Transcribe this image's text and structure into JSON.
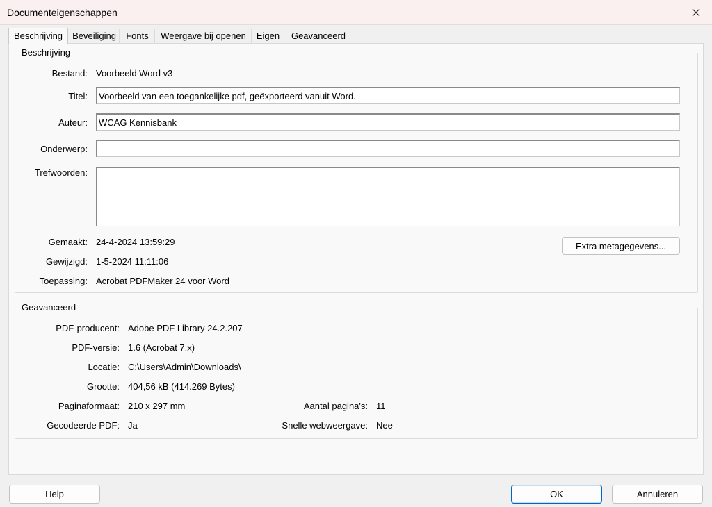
{
  "window": {
    "title": "Documenteigenschappen",
    "close_icon": "close-icon"
  },
  "tabs": [
    {
      "label": "Beschrijving"
    },
    {
      "label": "Beveiliging"
    },
    {
      "label": "Fonts"
    },
    {
      "label": "Weergave bij openen"
    },
    {
      "label": "Eigen"
    },
    {
      "label": "Geavanceerd"
    }
  ],
  "description": {
    "legend": "Beschrijving",
    "file_label": "Bestand:",
    "file_value": "Voorbeeld Word v3",
    "title_label": "Titel:",
    "title_value": "Voorbeeld van een toegankelijke pdf, geëxporteerd vanuit Word.",
    "author_label": "Auteur:",
    "author_value": "WCAG Kennisbank",
    "subject_label": "Onderwerp:",
    "subject_value": "",
    "keywords_label": "Trefwoorden:",
    "keywords_value": "",
    "created_label": "Gemaakt:",
    "created_value": "24-4-2024 13:59:29",
    "modified_label": "Gewijzigd:",
    "modified_value": "1-5-2024 11:11:06",
    "application_label": "Toepassing:",
    "application_value": "Acrobat PDFMaker 24 voor Word",
    "metadata_button": "Extra metagegevens..."
  },
  "advanced": {
    "legend": "Geavanceerd",
    "producer_label": "PDF-producent:",
    "producer_value": "Adobe PDF Library 24.2.207",
    "version_label": "PDF-versie:",
    "version_value": "1.6 (Acrobat 7.x)",
    "location_label": "Locatie:",
    "location_value": "C:\\Users\\Admin\\Downloads\\",
    "size_label": "Grootte:",
    "size_value": "404,56 kB (414.269 Bytes)",
    "page_size_label": "Paginaformaat:",
    "page_size_value": "210 x 297 mm",
    "page_count_label": "Aantal pagina's:",
    "page_count_value": "11",
    "tagged_label": "Gecodeerde PDF:",
    "tagged_value": "Ja",
    "fast_web_label": "Snelle webweergave:",
    "fast_web_value": "Nee"
  },
  "footer": {
    "help": "Help",
    "ok": "OK",
    "cancel": "Annuleren"
  }
}
